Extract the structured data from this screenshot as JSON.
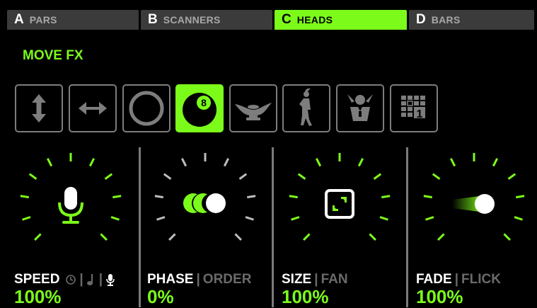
{
  "tabs": [
    {
      "letter": "A",
      "name": "PARS"
    },
    {
      "letter": "B",
      "name": "SCANNERS"
    },
    {
      "letter": "C",
      "name": "HEADS"
    },
    {
      "letter": "D",
      "name": "BARS"
    }
  ],
  "active_tab": "C",
  "section_title": "MOVE FX",
  "fx_buttons": [
    {
      "icon": "vertical-arrows-icon"
    },
    {
      "icon": "horizontal-arrows-icon"
    },
    {
      "icon": "circle-icon"
    },
    {
      "icon": "eight-ball-icon",
      "active": true,
      "label": "8"
    },
    {
      "icon": "magic-lamp-icon"
    },
    {
      "icon": "disco-dancer-icon"
    },
    {
      "icon": "dj-icon"
    },
    {
      "icon": "grid-pattern-icon",
      "label": "1"
    }
  ],
  "controls": [
    {
      "label": "SPEED",
      "value": "100%",
      "icon": "microphone-icon",
      "modes": [
        "clock-icon",
        "music-note-icon",
        "microphone-icon"
      ]
    },
    {
      "label": "PHASE",
      "alt_label": "ORDER",
      "value": "0%",
      "icon": "phase-icon"
    },
    {
      "label": "SIZE",
      "alt_label": "FAN",
      "value": "100%",
      "icon": "expand-icon"
    },
    {
      "label": "FADE",
      "alt_label": "FLICK",
      "value": "100%",
      "icon": "fade-icon"
    }
  ],
  "colors": {
    "accent": "#7cfb1a",
    "inactive": "#7d7d7d",
    "tab_bg": "#3b3b3b",
    "background": "#000000"
  }
}
